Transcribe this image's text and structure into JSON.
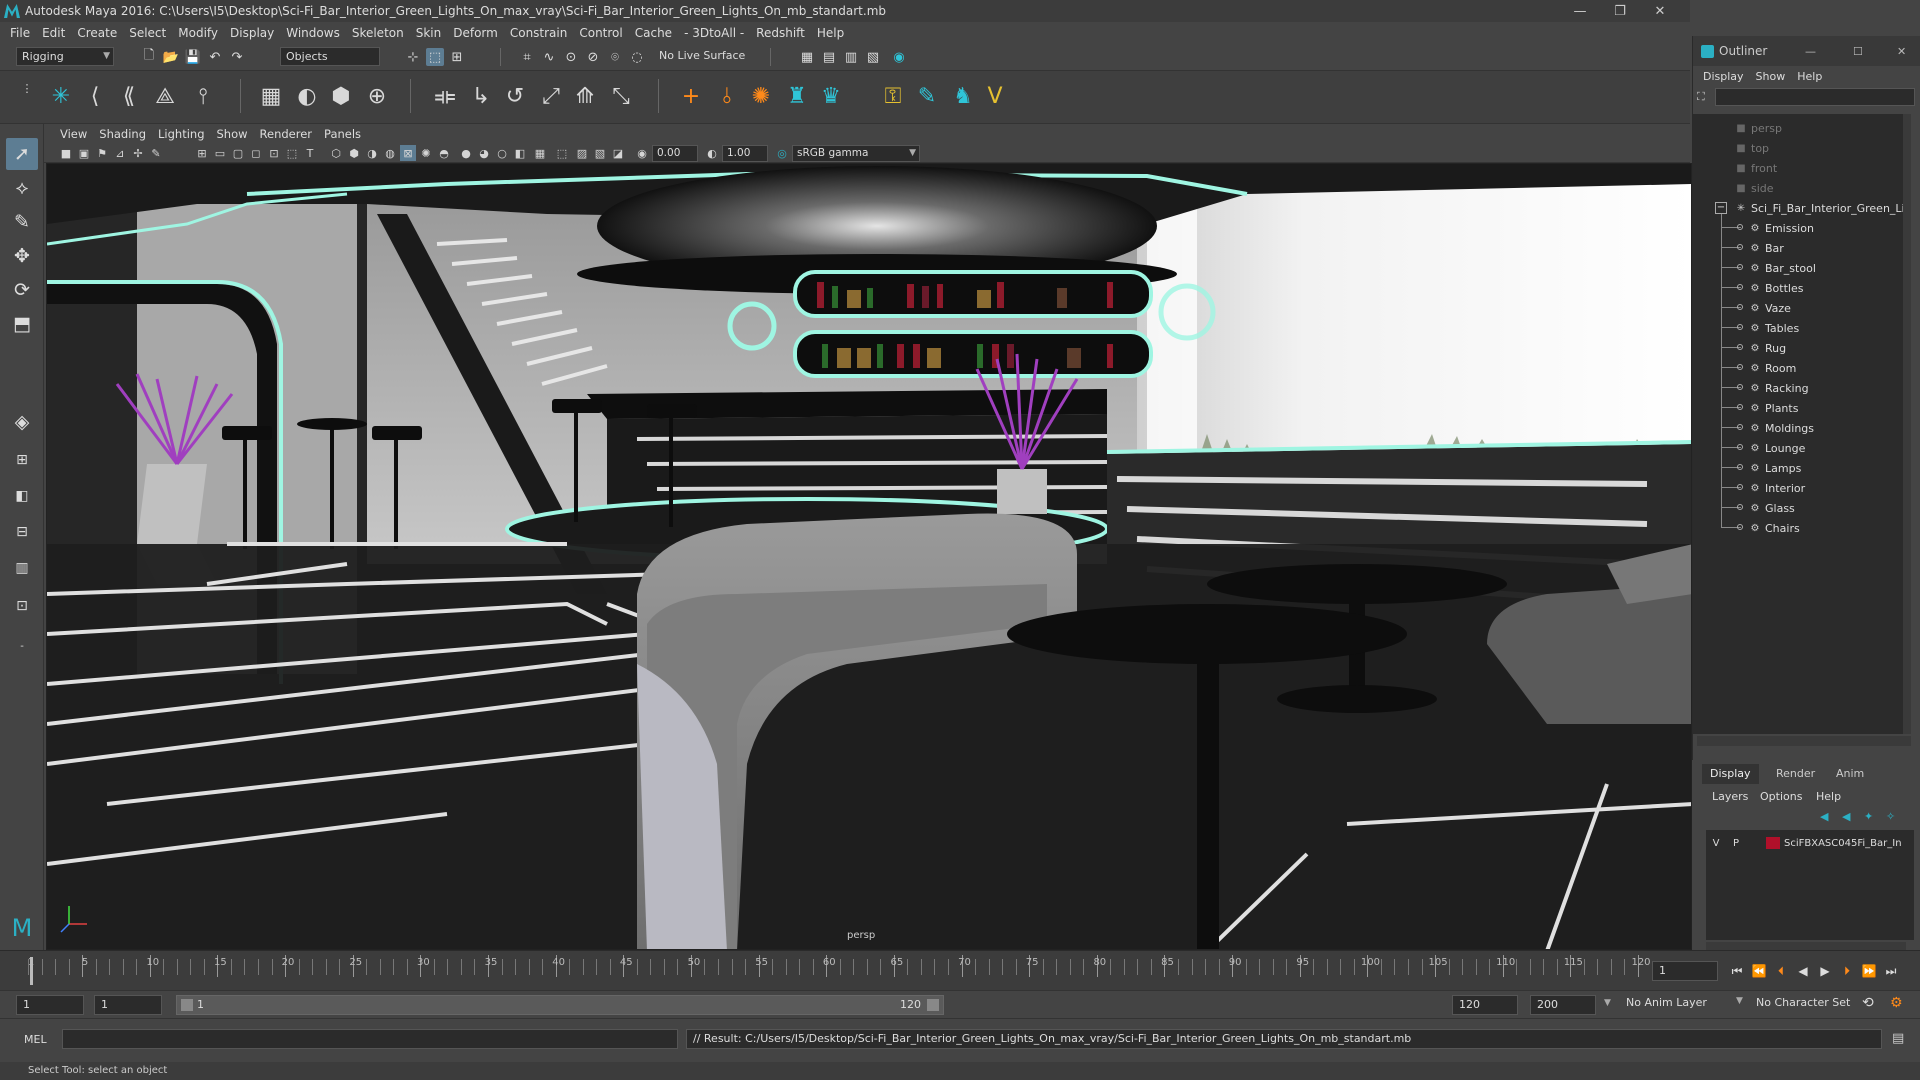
{
  "window": {
    "title": "Autodesk Maya 2016: C:\\Users\\I5\\Desktop\\Sci-Fi_Bar_Interior_Green_Lights_On_max_vray\\Sci-Fi_Bar_Interior_Green_Lights_On_mb_standart.mb",
    "minimize": "—",
    "restore": "❐",
    "close": "✕"
  },
  "menubar": [
    "File",
    "Edit",
    "Create",
    "Select",
    "Modify",
    "Display",
    "Windows",
    "Skeleton",
    "Skin",
    "Deform",
    "Constrain",
    "Control",
    "Cache",
    "- 3DtoAll -",
    "Redshift",
    "Help"
  ],
  "statusline": {
    "menu_set": "Rigging",
    "selection_mode": "Objects",
    "live_surface": "No Live Surface"
  },
  "viewport": {
    "menu": [
      "View",
      "Shading",
      "Lighting",
      "Show",
      "Renderer",
      "Panels"
    ],
    "exposure": "0.00",
    "gamma": "1.00",
    "color_space": "sRGB gamma",
    "camera_label": "persp"
  },
  "outliner": {
    "title": "Outliner",
    "menu": [
      "Display",
      "Show",
      "Help"
    ],
    "cameras": [
      "persp",
      "top",
      "front",
      "side"
    ],
    "root": "Sci_Fi_Bar_Interior_Green_Lig",
    "groups": [
      "Emission",
      "Bar",
      "Bar_stool",
      "Bottles",
      "Vaze",
      "Tables",
      "Rug",
      "Room",
      "Racking",
      "Plants",
      "Moldings",
      "Lounge",
      "Lamps",
      "Interior",
      "Glass",
      "Chairs"
    ]
  },
  "layers": {
    "tabs": [
      "Display",
      "Render",
      "Anim"
    ],
    "active_tab": "Display",
    "menu": [
      "Layers",
      "Options",
      "Help"
    ],
    "layer": {
      "visible": "V",
      "playback": "P",
      "name": "SciFBXASC045Fi_Bar_In",
      "color": "#b0102a"
    }
  },
  "timeline": {
    "ticks": [
      1,
      5,
      10,
      15,
      20,
      25,
      30,
      35,
      40,
      45,
      50,
      55,
      60,
      65,
      70,
      75,
      80,
      85,
      90,
      95,
      100,
      105,
      110,
      115,
      120
    ],
    "current_frame": "1"
  },
  "range": {
    "start": "1",
    "playback_start": "1",
    "slider_start": "1",
    "slider_end": "120",
    "playback_end": "120",
    "end": "200",
    "anim_layer": "No Anim Layer",
    "character_set": "No Character Set"
  },
  "command": {
    "language": "MEL",
    "result": "// Result: C:/Users/I5/Desktop/Sci-Fi_Bar_Interior_Green_Lights_On_max_vray/Sci-Fi_Bar_Interior_Green_Lights_On_mb_standart.mb"
  },
  "help_line": "Select Tool: select an object",
  "colors": {
    "accent": "#5d7d93",
    "maya_teal": "#2bb0c4",
    "glow": "#9ff5e2"
  }
}
